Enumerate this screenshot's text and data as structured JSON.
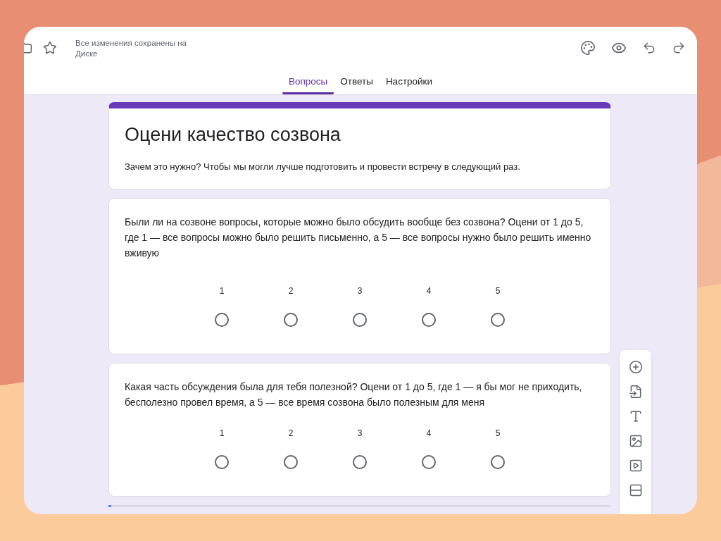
{
  "header": {
    "save_status": "Все изменения сохранены на Диске"
  },
  "tabs": [
    {
      "label": "Вопросы",
      "selected": true
    },
    {
      "label": "Ответы",
      "selected": false
    },
    {
      "label": "Настройки",
      "selected": false
    }
  ],
  "form": {
    "title": "Оцени качество созвона",
    "description": "Зачем это нужно? Чтобы мы могли лучше подготовить и провести встречу в следующий раз."
  },
  "questions": [
    {
      "text": "Были ли на созвоне вопросы, которые можно было обсудить вообще без созвона? Оцени от 1 до 5, где 1 — все вопросы можно было решить письменно, а 5 — все вопросы нужно было решить именно вживую",
      "options": [
        {
          "label": "1",
          "selected": false
        },
        {
          "label": "2",
          "selected": false
        },
        {
          "label": "3",
          "selected": false
        },
        {
          "label": "4",
          "selected": false
        },
        {
          "label": "5",
          "selected": false
        }
      ]
    },
    {
      "text": "Какая часть обсуждения была для тебя полезной? Оцени от 1 до 5, где 1 — я бы мог не приходить, бесполезно провел время, а 5 — все время созвона было полезным для меня",
      "options": [
        {
          "label": "1",
          "selected": false
        },
        {
          "label": "2",
          "selected": false
        },
        {
          "label": "3",
          "selected": false
        },
        {
          "label": "4",
          "selected": false
        },
        {
          "label": "5",
          "selected": false
        }
      ]
    }
  ]
}
